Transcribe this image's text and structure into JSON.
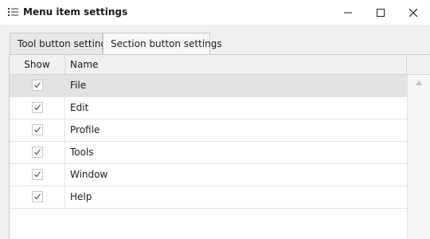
{
  "window": {
    "title": "Menu item settings",
    "icon": "list-settings-icon",
    "controls": [
      "minimize-icon",
      "maximize-icon",
      "close-icon"
    ]
  },
  "tabs": [
    {
      "label": "Tool button settings",
      "active": false
    },
    {
      "label": "Section button settings",
      "active": true
    }
  ],
  "grid": {
    "columns": [
      "Show",
      "Name"
    ],
    "rows": [
      {
        "show": true,
        "name": "File",
        "selected": true
      },
      {
        "show": true,
        "name": "Edit",
        "selected": false
      },
      {
        "show": true,
        "name": "Profile",
        "selected": false
      },
      {
        "show": true,
        "name": "Tools",
        "selected": false
      },
      {
        "show": true,
        "name": "Window",
        "selected": false
      },
      {
        "show": true,
        "name": "Help",
        "selected": false
      }
    ]
  },
  "colors": {
    "titlebar": "#ffffff",
    "background": "#f0f0f0",
    "selected_row": "#e2e2e2",
    "border": "#c9c9c9"
  }
}
